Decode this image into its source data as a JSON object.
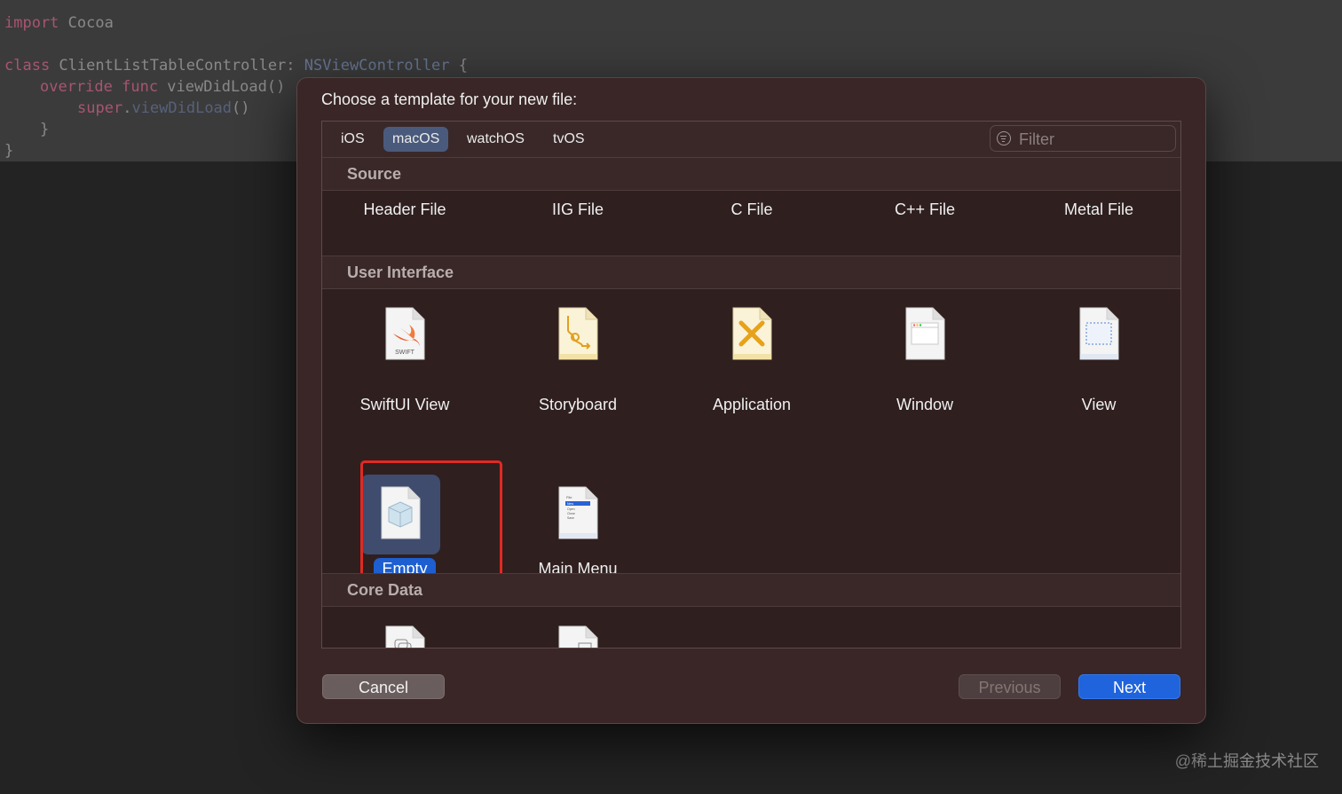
{
  "editor": {
    "lines": [
      [
        "import",
        " Cocoa"
      ],
      [
        "class",
        " ClientListTableController: ",
        "NSViewController",
        " {"
      ],
      [
        "override func",
        " viewDidLoad()"
      ],
      [
        "super",
        ".",
        "viewDidLoad",
        "()"
      ],
      [
        "}"
      ],
      [
        "}"
      ]
    ]
  },
  "dialog": {
    "title": "Choose a template for your new file:",
    "tabs": [
      {
        "label": "iOS",
        "active": false
      },
      {
        "label": "macOS",
        "active": true
      },
      {
        "label": "watchOS",
        "active": false
      },
      {
        "label": "tvOS",
        "active": false
      }
    ],
    "filter": {
      "placeholder": "Filter",
      "value": ""
    },
    "sections": {
      "source": {
        "title": "Source",
        "items": [
          "Header File",
          "IIG File",
          "C File",
          "C++ File",
          "Metal File"
        ]
      },
      "user_interface": {
        "title": "User Interface",
        "items": [
          "SwiftUI View",
          "Storyboard",
          "Application",
          "Window",
          "View",
          "Empty",
          "Main Menu"
        ],
        "selected": "Empty",
        "swift_badge": "SWIFT",
        "menu_preview": [
          "File",
          "New",
          "Open",
          "Close",
          "Save"
        ]
      },
      "core_data": {
        "title": "Core Data"
      }
    },
    "buttons": {
      "cancel": "Cancel",
      "previous": "Previous",
      "next": "Next"
    },
    "colors": {
      "accent": "#1f63dd",
      "selection_box": "#e02a23",
      "dialog_bg": "#3a2626"
    }
  },
  "watermark": "@稀土掘金技术社区"
}
